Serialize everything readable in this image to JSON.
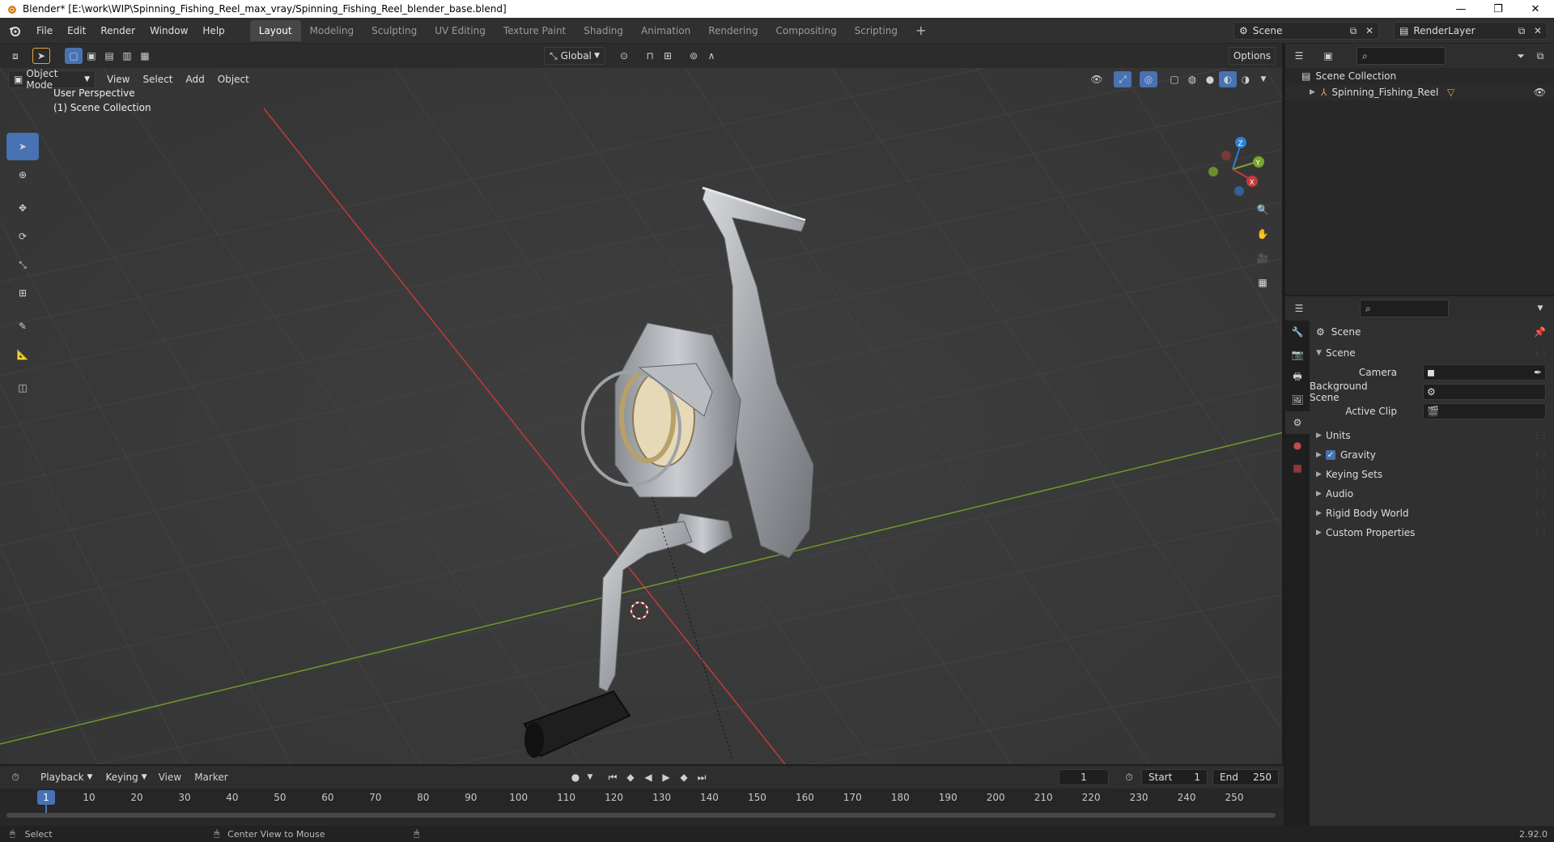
{
  "window": {
    "title": "Blender* [E:\\work\\WIP\\Spinning_Fishing_Reel_max_vray/Spinning_Fishing_Reel_blender_base.blend]",
    "controls": [
      "—",
      "❐",
      "✕"
    ]
  },
  "menu": [
    "File",
    "Edit",
    "Render",
    "Window",
    "Help"
  ],
  "workspaces": [
    {
      "label": "Layout",
      "active": true
    },
    {
      "label": "Modeling"
    },
    {
      "label": "Sculpting"
    },
    {
      "label": "UV Editing"
    },
    {
      "label": "Texture Paint"
    },
    {
      "label": "Shading"
    },
    {
      "label": "Animation"
    },
    {
      "label": "Rendering"
    },
    {
      "label": "Compositing"
    },
    {
      "label": "Scripting"
    }
  ],
  "scene_selector": {
    "value": "Scene"
  },
  "layer_selector": {
    "value": "RenderLayer"
  },
  "viewport": {
    "mode": "Object Mode",
    "menus": [
      "View",
      "Select",
      "Add",
      "Object"
    ],
    "transform_orientation": "Global",
    "options_label": "Options",
    "overlay_line1": "User Perspective",
    "overlay_line2": "(1) Scene Collection",
    "tools": [
      "select-box",
      "cursor",
      "move",
      "rotate",
      "scale",
      "transform",
      "annotate",
      "measure",
      "add-cube"
    ]
  },
  "outliner": {
    "root": "Scene Collection",
    "items": [
      {
        "label": "Spinning_Fishing_Reel"
      }
    ]
  },
  "properties": {
    "context_title": "Scene",
    "panel_title": "Scene",
    "fields": [
      {
        "label": "Camera",
        "value": ""
      },
      {
        "label": "Background Scene",
        "value": ""
      },
      {
        "label": "Active Clip",
        "value": ""
      }
    ],
    "subpanels": [
      {
        "label": "Units",
        "checkbox": false
      },
      {
        "label": "Gravity",
        "checkbox": true,
        "checked": true
      },
      {
        "label": "Keying Sets",
        "checkbox": false
      },
      {
        "label": "Audio",
        "checkbox": false
      },
      {
        "label": "Rigid Body World",
        "checkbox": false
      },
      {
        "label": "Custom Properties",
        "checkbox": false
      }
    ]
  },
  "timeline": {
    "menus": [
      "Playback",
      "Keying",
      "View",
      "Marker"
    ],
    "current_frame": "1",
    "start_label": "Start",
    "start": "1",
    "end_label": "End",
    "end": "250",
    "ticks": [
      "1",
      "10",
      "20",
      "30",
      "40",
      "50",
      "60",
      "70",
      "80",
      "90",
      "100",
      "110",
      "120",
      "130",
      "140",
      "150",
      "160",
      "170",
      "180",
      "190",
      "200",
      "210",
      "220",
      "230",
      "240",
      "250"
    ]
  },
  "statusbar": {
    "left": "Select",
    "middle": "Center View to Mouse",
    "version": "2.92.0"
  },
  "colors": {
    "accent": "#4772b3",
    "x_axis": "#c23a3a",
    "y_axis": "#7aa52b",
    "z_axis": "#2f7fd6"
  }
}
